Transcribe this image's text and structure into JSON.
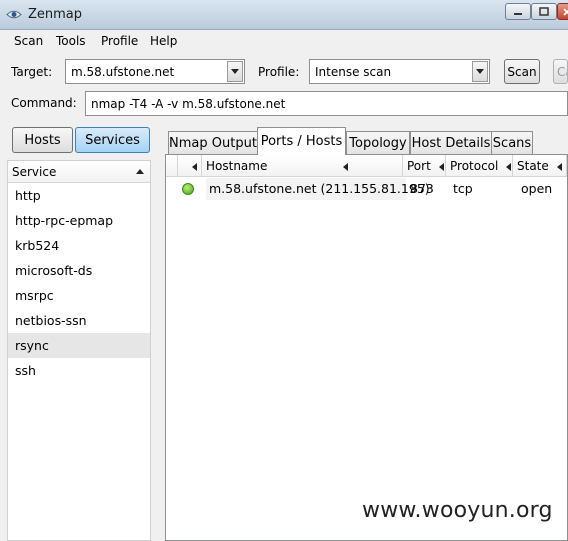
{
  "window": {
    "title": "Zenmap"
  },
  "menu": {
    "scan": "Scan",
    "tools": "Tools",
    "profile": "Profile",
    "help": "Help"
  },
  "toolbar": {
    "target_label": "Target:",
    "target_value": "m.58.ufstone.net",
    "profile_label": "Profile:",
    "profile_value": "Intense scan",
    "scan_button": "Scan",
    "cancel_button": "Ca"
  },
  "command": {
    "label": "Command:",
    "value": "nmap -T4 -A -v m.58.ufstone.net"
  },
  "left_pane": {
    "hosts_button": "Hosts",
    "services_button": "Services",
    "column_header": "Service",
    "services": [
      "http",
      "http-rpc-epmap",
      "krb524",
      "microsoft-ds",
      "msrpc",
      "netbios-ssn",
      "rsync",
      "ssh"
    ],
    "selected_service": "rsync"
  },
  "tabs": [
    "Nmap Output",
    "Ports / Hosts",
    "Topology",
    "Host Details",
    "Scans"
  ],
  "active_tab": "Ports / Hosts",
  "ports_table": {
    "headers": {
      "hostname": "Hostname",
      "port": "Port",
      "protocol": "Protocol",
      "state": "State"
    },
    "rows": [
      {
        "hostname": "m.58.ufstone.net (211.155.81.195)",
        "port": "873",
        "protocol": "tcp",
        "state": "open",
        "status_color": "#4aa316"
      }
    ]
  },
  "watermark": "www.wooyun.org",
  "icons": {
    "app": "eye-icon",
    "minimize": "minimize-icon",
    "maximize": "maximize-icon",
    "close": "close-icon"
  },
  "colors": {
    "selected_toggle": "#a5d2f3",
    "open_status": "#4aa316"
  }
}
